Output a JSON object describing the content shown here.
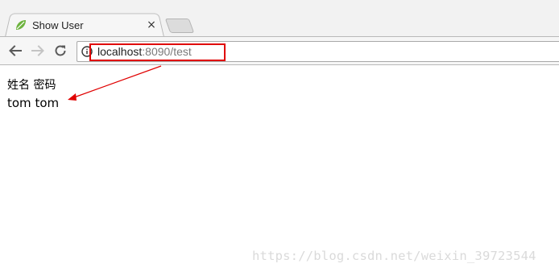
{
  "tab": {
    "title": "Show User",
    "favicon": "spring-leaf-icon",
    "close_glyph": "×",
    "accent_color": "#6db33f"
  },
  "toolbar": {
    "back": "arrow-left-icon",
    "forward": "arrow-right-icon",
    "reload": "reload-icon"
  },
  "address": {
    "host": "localhost",
    "rest": ":8090/test",
    "info_icon": "info-icon"
  },
  "page": {
    "header": {
      "name": "姓名",
      "password": "密码"
    },
    "row": {
      "name": "tom",
      "password": "tom"
    }
  },
  "annotation": {
    "highlight_color": "#e00000"
  },
  "watermark": "https://blog.csdn.net/weixin_39723544"
}
